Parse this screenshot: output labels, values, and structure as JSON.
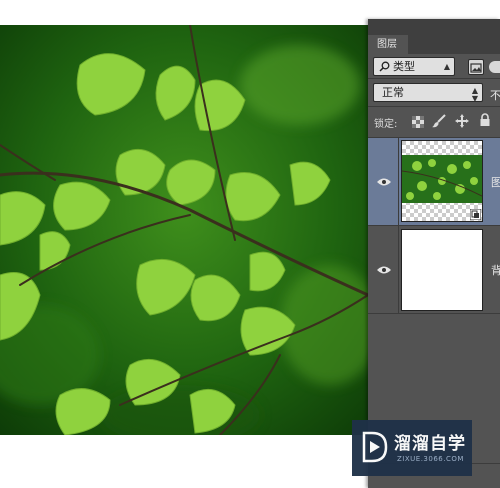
{
  "canvas": {
    "description": "",
    "dominant_colors": [
      "#1e5c0e",
      "#8fd23e",
      "#3a2f1d"
    ]
  },
  "layers_panel": {
    "tab_label": "图层",
    "filter": {
      "label": "类型"
    },
    "blend_mode": {
      "label": "正常",
      "opacity_partial": "不"
    },
    "lock_label": "锁定:",
    "layers": [
      {
        "name_partial": "图",
        "visible": true,
        "selected": true,
        "thumbnail": "fern-photo-smart-object"
      },
      {
        "name_partial": "背",
        "visible": true,
        "selected": false,
        "thumbnail": "white"
      }
    ]
  },
  "watermark": {
    "title": "溜溜自学",
    "url": "ZIXUE.3066.COM"
  },
  "icons": {
    "search": "search-icon",
    "image_filter": "image-filter-icon",
    "eye": "eye-icon",
    "lock_pixels": "lock-transparent-pixels-icon",
    "brush": "brush-icon",
    "move": "move-icon",
    "lock": "lock-icon",
    "smart_object": "smart-object-badge-icon"
  }
}
